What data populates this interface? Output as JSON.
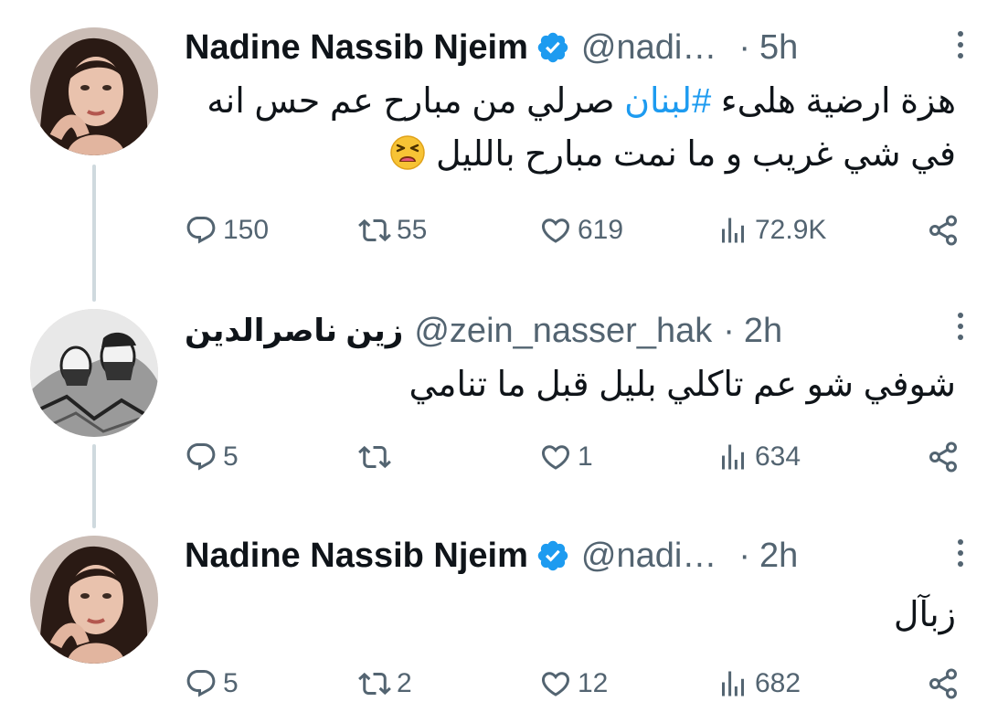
{
  "tweets": [
    {
      "name": "Nadine Nassib Njeim",
      "verified": true,
      "handle": "@nadi…",
      "time": "5h",
      "text_before": "هزة ارضية هلىء ",
      "hashtag": "#لبنان",
      "text_after": " صرلي من مبارح عم حس انه في شي غريب و ما نمت مبارح بالليل",
      "emoji": "tired-face-emoji",
      "replies": "150",
      "reposts": "55",
      "likes": "619",
      "views": "72.9K"
    },
    {
      "name": "زين ناصرالدين",
      "verified": false,
      "handle": "@zein_nasser_hak",
      "time": "2h",
      "text": "شوفي شو عم تاكلي بليل قبل ما تنامي",
      "replies": "5",
      "reposts": "",
      "likes": "1",
      "views": "634"
    },
    {
      "name": "Nadine Nassib Njeim",
      "verified": true,
      "handle": "@nadi…",
      "time": "2h",
      "text": "زبآل",
      "replies": "5",
      "reposts": "2",
      "likes": "12",
      "views": "682"
    }
  ],
  "icons": {
    "reply": "reply-icon",
    "repost": "repost-icon",
    "like": "heart-icon",
    "views": "views-icon",
    "share": "share-icon",
    "verified": "verified-badge-icon",
    "more": "more-icon"
  },
  "colors": {
    "text": "#0f1419",
    "secondary": "#536471",
    "accent": "#1d9bf0",
    "thread_line": "#cfd9de"
  }
}
